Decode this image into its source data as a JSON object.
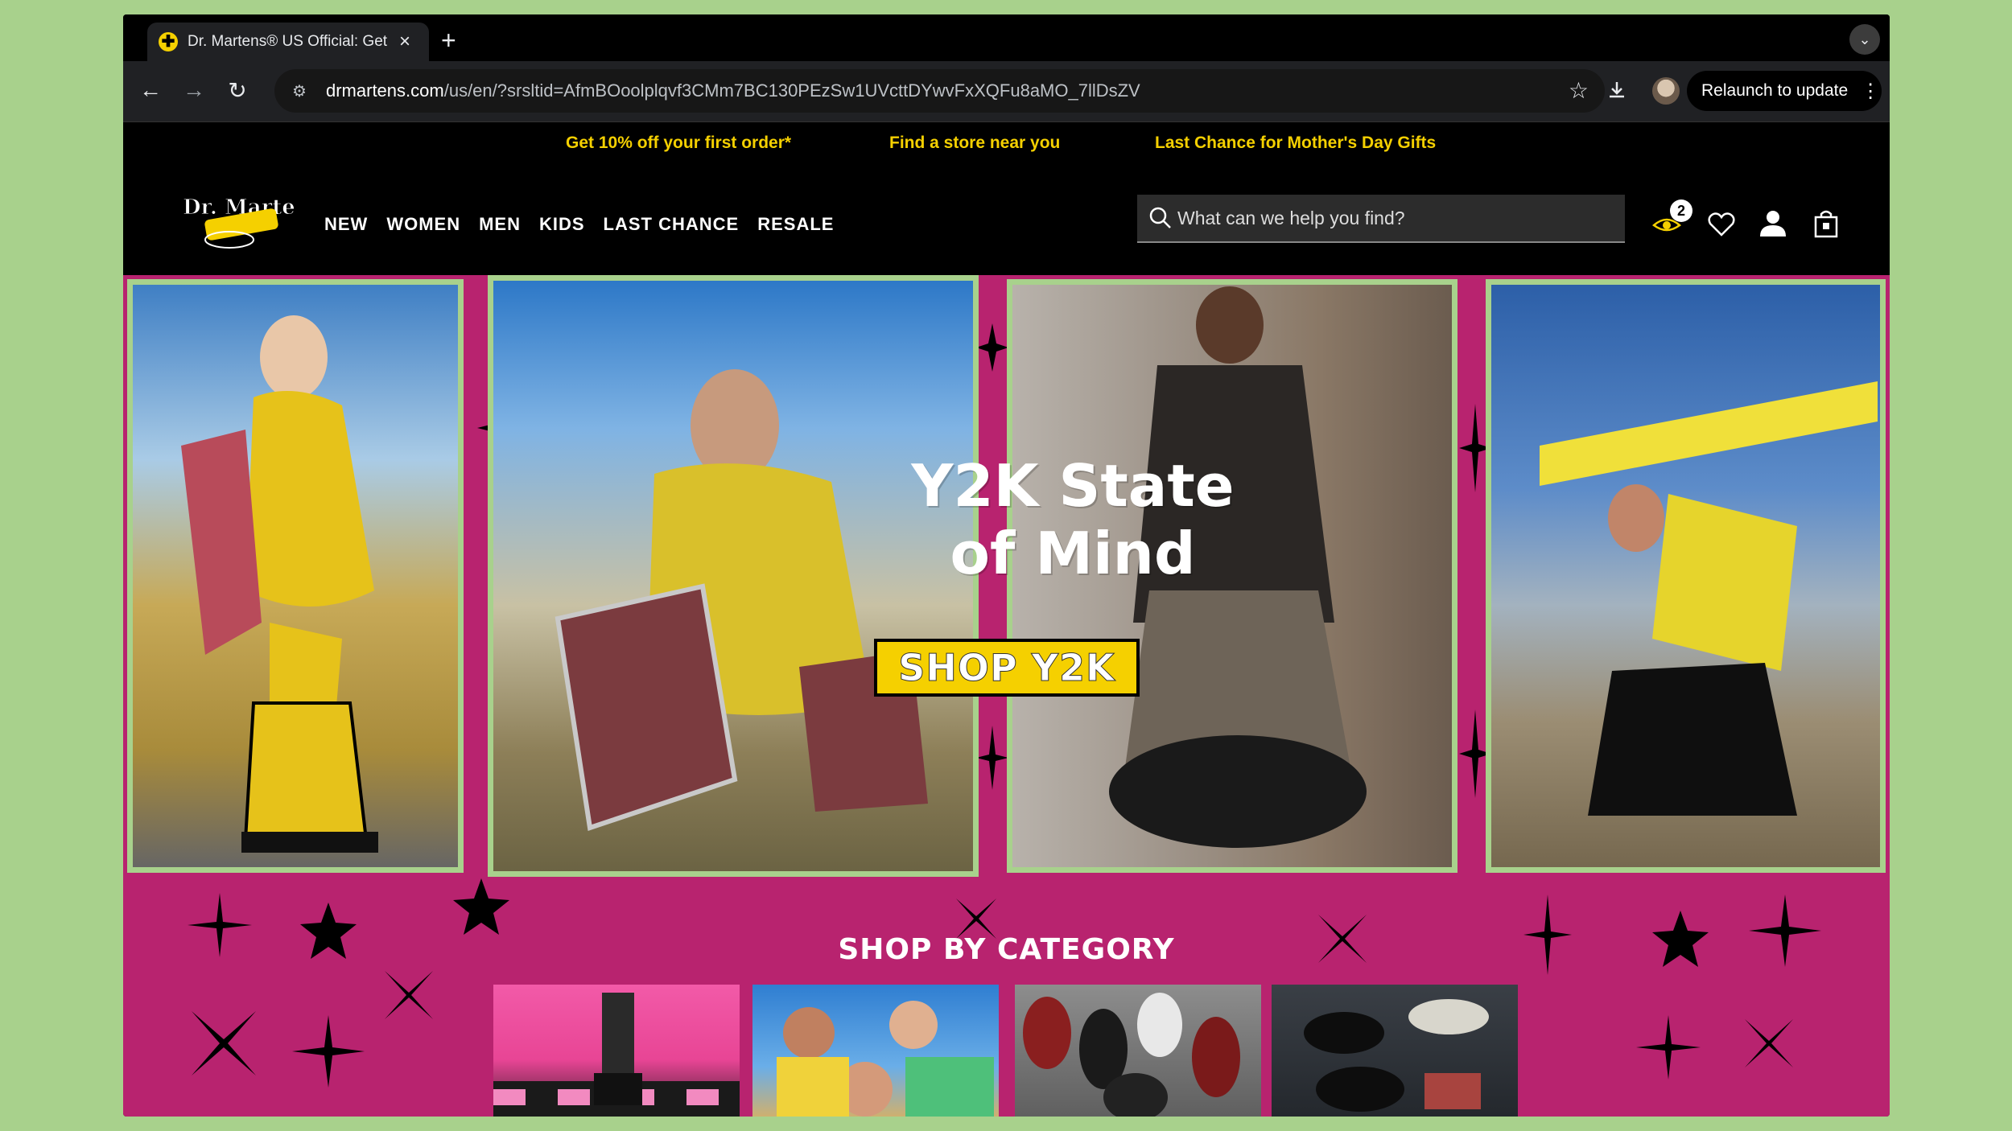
{
  "browser": {
    "tab_title": "Dr. Martens® US Official: Get",
    "url_host": "drmartens.com",
    "url_path": "/us/en/?srsltid=AfmBOoolplqvf3CMm7BC130PEzSw1UVcttDYwvFxXQFu8aMO_7llDsZV",
    "relaunch_label": "Relaunch to update"
  },
  "promo": {
    "links": [
      "Get 10% off your first order*",
      "Find a store near you",
      "Last Chance for Mother's Day Gifts"
    ]
  },
  "header": {
    "logo_text": "Dr. Martens",
    "nav": [
      "NEW",
      "WOMEN",
      "MEN",
      "KIDS",
      "LAST CHANCE",
      "RESALE"
    ],
    "search_placeholder": "What can we help you find?",
    "rewards_count": "2"
  },
  "hero": {
    "title_line1": "Y2K State",
    "title_line2": "of Mind",
    "cta_label": "SHOP Y2K"
  },
  "category": {
    "title": "SHOP BY CATEGORY"
  },
  "colors": {
    "magenta": "#b8236f",
    "lime": "#a8d18c",
    "yellow": "#f5d000"
  }
}
